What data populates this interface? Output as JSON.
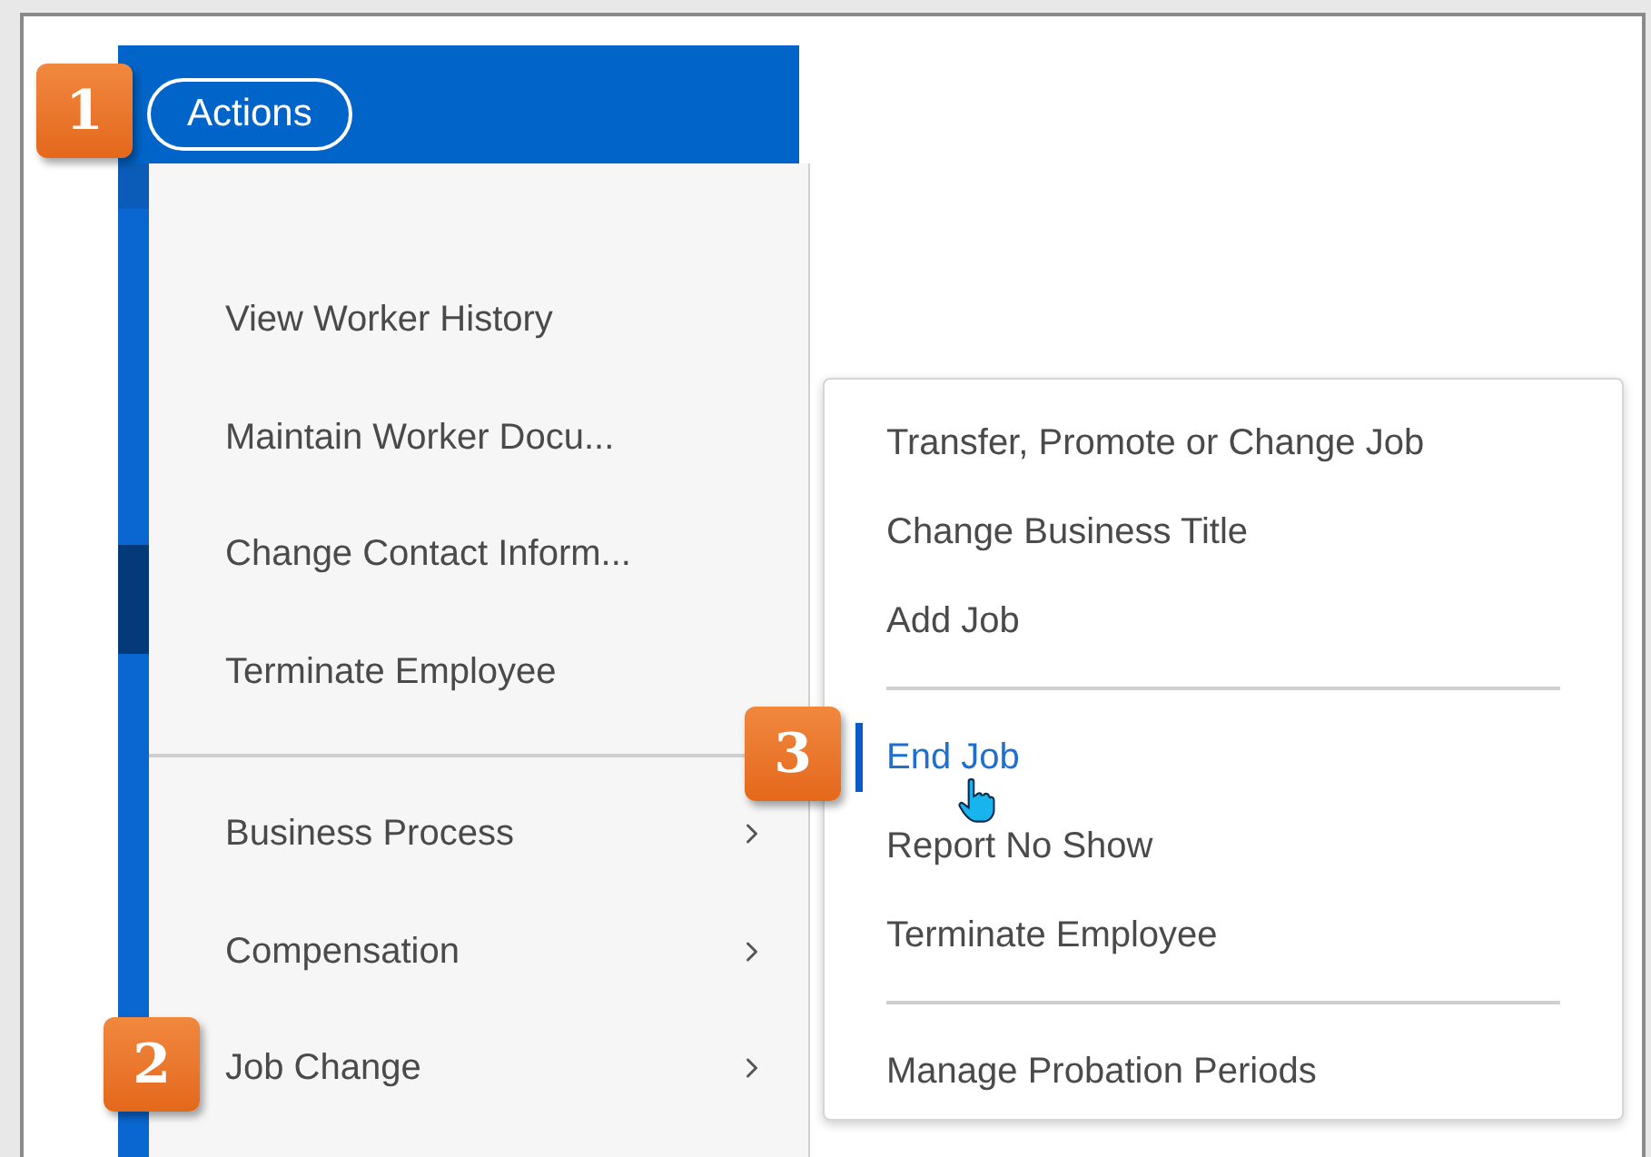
{
  "actions_button": {
    "label": "Actions"
  },
  "menu": {
    "sections": [
      {
        "items": [
          {
            "label": "View Worker History",
            "kind": "action"
          },
          {
            "label": "Maintain Worker Docu...",
            "kind": "action"
          },
          {
            "label": "Change Contact Inform...",
            "kind": "action"
          },
          {
            "label": "Terminate Employee",
            "kind": "action"
          }
        ]
      },
      {
        "items": [
          {
            "label": "Business Process",
            "kind": "submenu"
          },
          {
            "label": "Compensation",
            "kind": "submenu"
          },
          {
            "label": "Job Change",
            "kind": "submenu"
          }
        ]
      }
    ]
  },
  "submenu": {
    "sections": [
      {
        "items": [
          {
            "label": "Transfer, Promote or Change Job",
            "selected": false
          },
          {
            "label": "Change Business Title",
            "selected": false
          },
          {
            "label": "Add Job",
            "selected": false
          }
        ]
      },
      {
        "items": [
          {
            "label": "End Job",
            "selected": true
          },
          {
            "label": "Report No Show",
            "selected": false
          },
          {
            "label": "Terminate Employee",
            "selected": false
          }
        ]
      },
      {
        "items": [
          {
            "label": "Manage Probation Periods",
            "selected": false
          }
        ]
      }
    ]
  },
  "callouts": [
    {
      "label": "1"
    },
    {
      "label": "2"
    },
    {
      "label": "3"
    }
  ]
}
